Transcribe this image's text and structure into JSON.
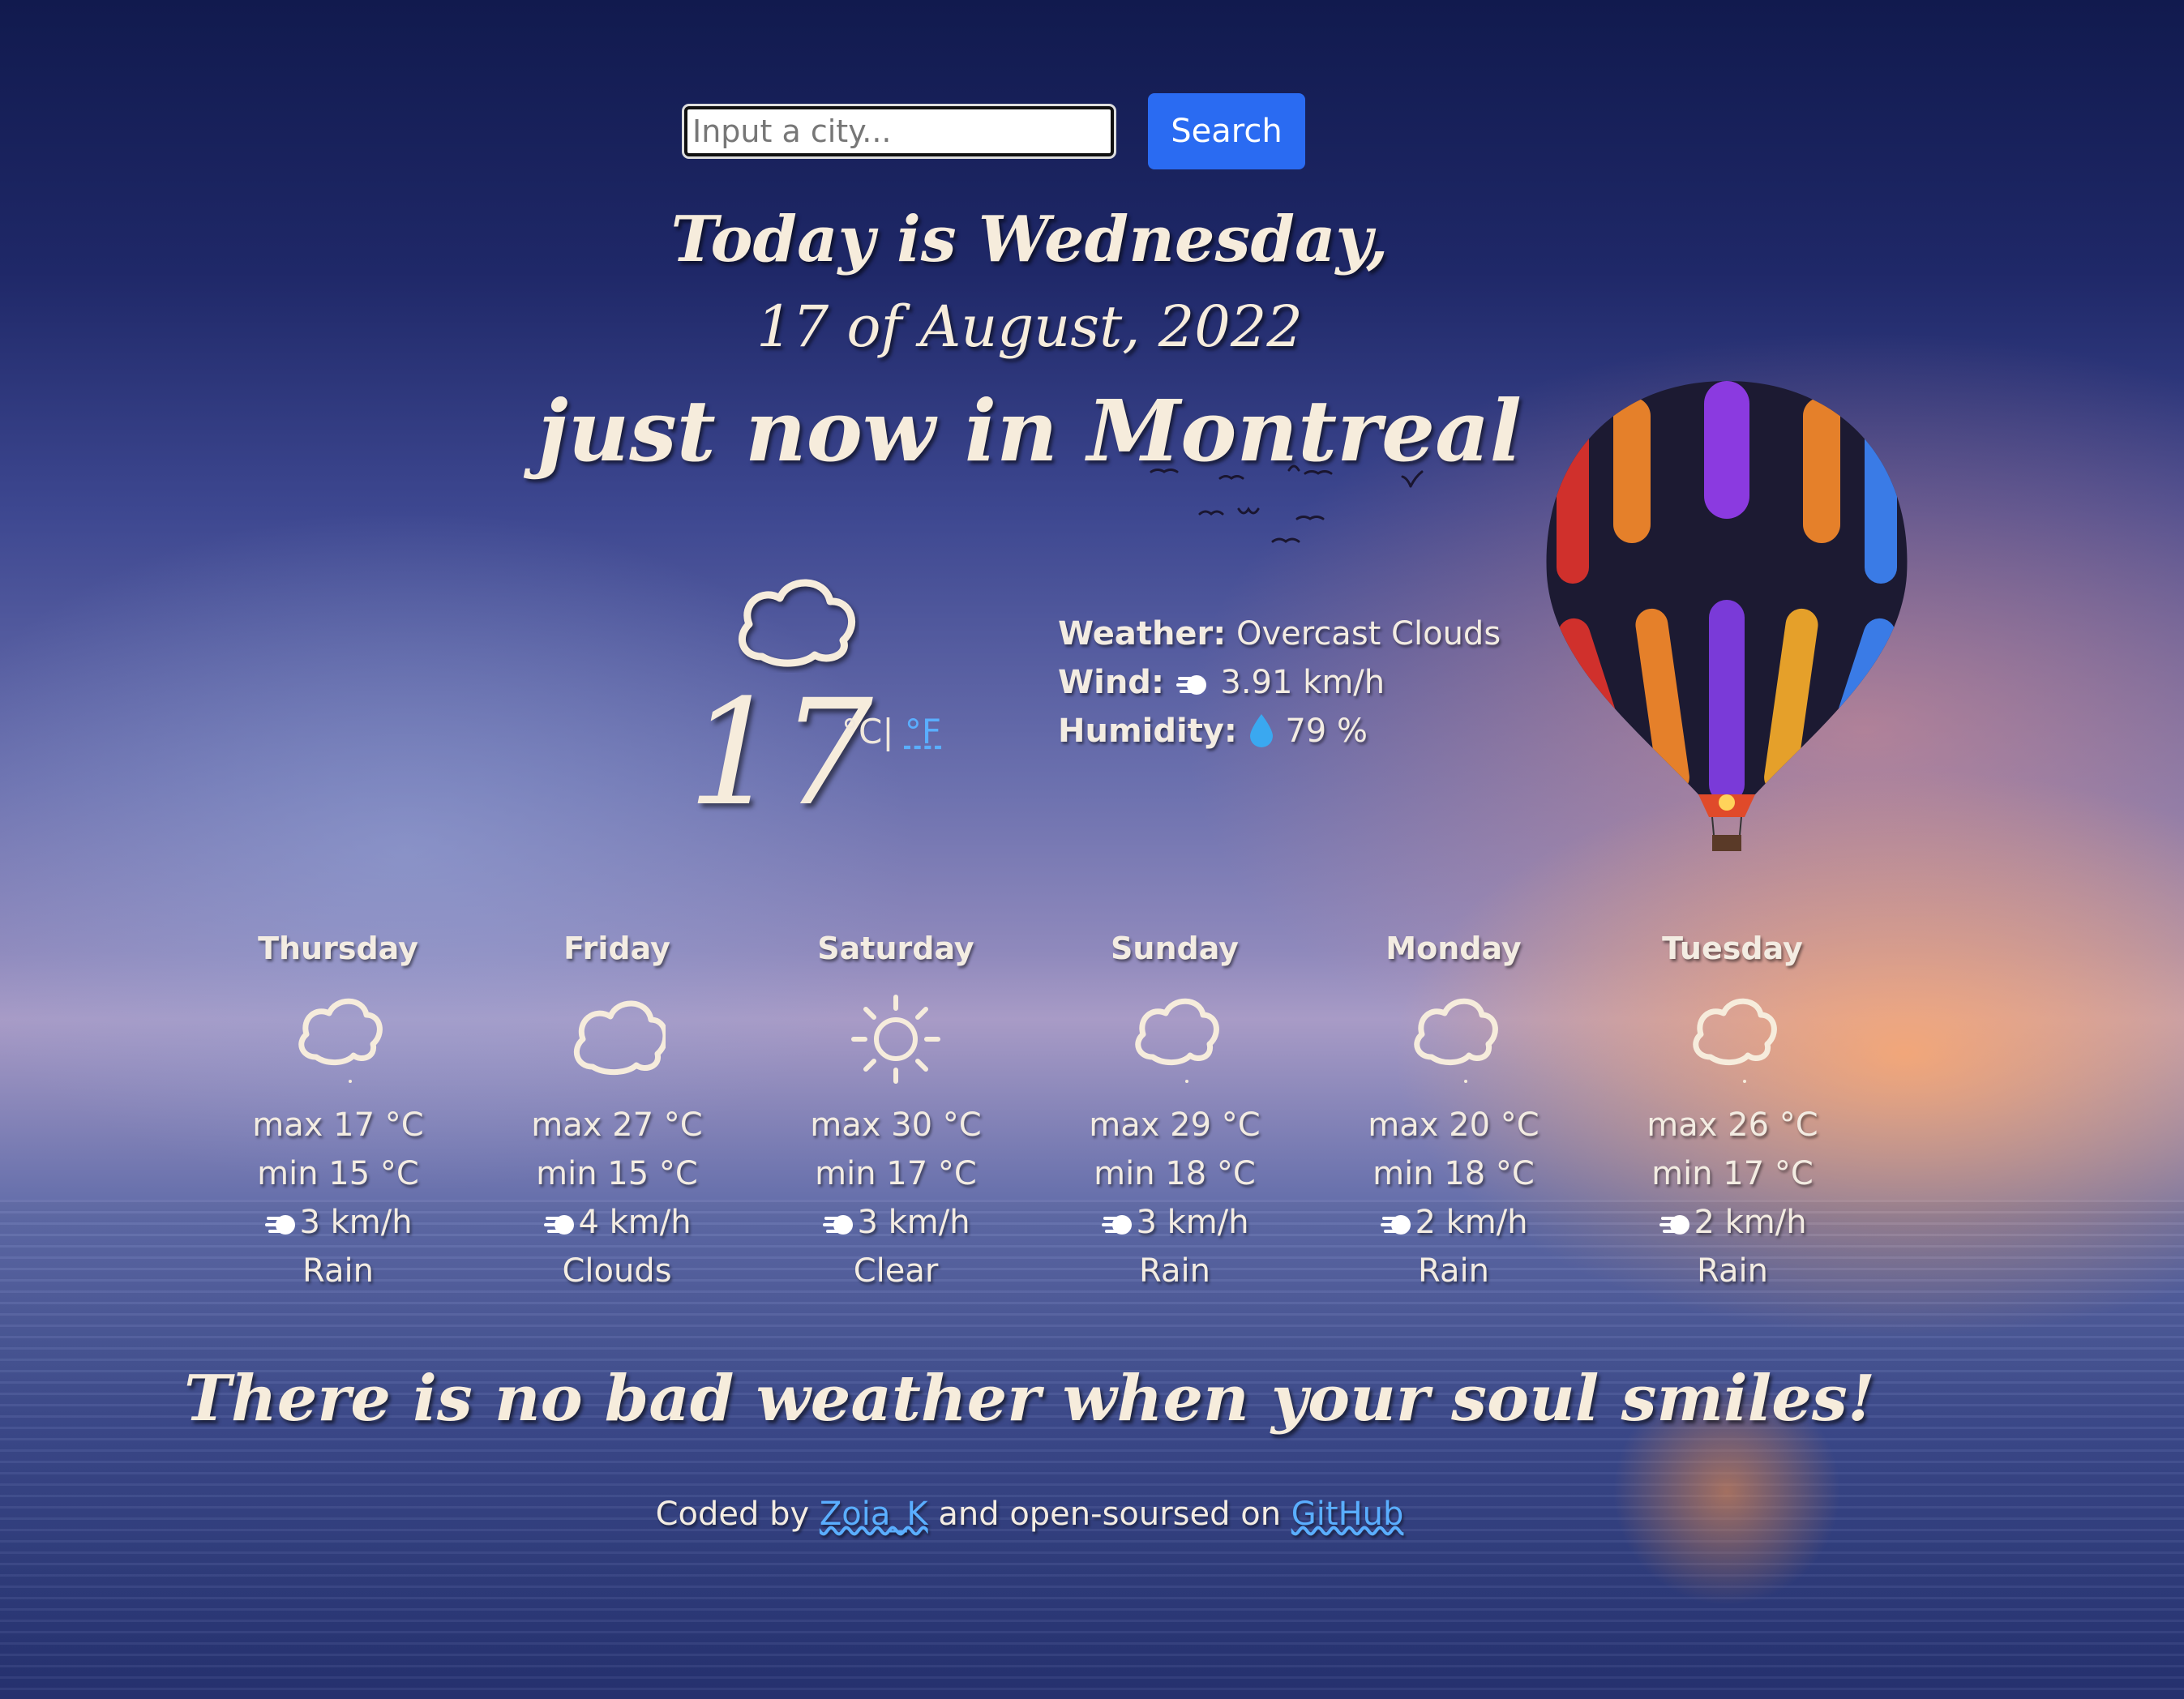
{
  "search": {
    "placeholder": "Input a city...",
    "button_label": "Search"
  },
  "header": {
    "line1": "Today is Wednesday,",
    "line2": "17 of August, 2022",
    "line3": "just now in Montreal"
  },
  "current": {
    "icon": "cloud-icon",
    "temperature": "17",
    "unit_c": "°C|",
    "unit_f": "°F",
    "weather_label": "Weather:",
    "weather_value": "Overcast Clouds",
    "wind_label": "Wind:",
    "wind_icon": "wind-icon",
    "wind_value": "3.91 km/h",
    "humidity_label": "Humidity:",
    "humidity_icon": "droplet-icon",
    "humidity_value": "79 %"
  },
  "forecast": [
    {
      "day": "Thursday",
      "icon": "rain-cloud-icon",
      "max": "max 17 °C",
      "min": "min 15 °C",
      "wind": "3 km/h",
      "desc": "Rain"
    },
    {
      "day": "Friday",
      "icon": "cloud-icon",
      "max": "max 27 °C",
      "min": "min 15 °C",
      "wind": "4 km/h",
      "desc": "Clouds"
    },
    {
      "day": "Saturday",
      "icon": "sun-icon",
      "max": "max 30 °C",
      "min": "min 17 °C",
      "wind": "3 km/h",
      "desc": "Clear"
    },
    {
      "day": "Sunday",
      "icon": "rain-cloud-icon",
      "max": "max 29 °C",
      "min": "min 18 °C",
      "wind": "3 km/h",
      "desc": "Rain"
    },
    {
      "day": "Monday",
      "icon": "rain-cloud-icon",
      "max": "max 20 °C",
      "min": "min 18 °C",
      "wind": "2 km/h",
      "desc": "Rain"
    },
    {
      "day": "Tuesday",
      "icon": "rain-cloud-icon",
      "max": "max 26 °C",
      "min": "min 17 °C",
      "wind": "2 km/h",
      "desc": "Rain"
    }
  ],
  "motto": "There is no bad weather when your soul smiles!",
  "footer": {
    "prefix": "Coded by",
    "author": "Zoia_K",
    "middle": "and open-soursed on",
    "repo": "GitHub"
  },
  "colors": {
    "accent_button": "#2a6bf2",
    "link": "#5aaeff",
    "text": "#f3ece2"
  }
}
